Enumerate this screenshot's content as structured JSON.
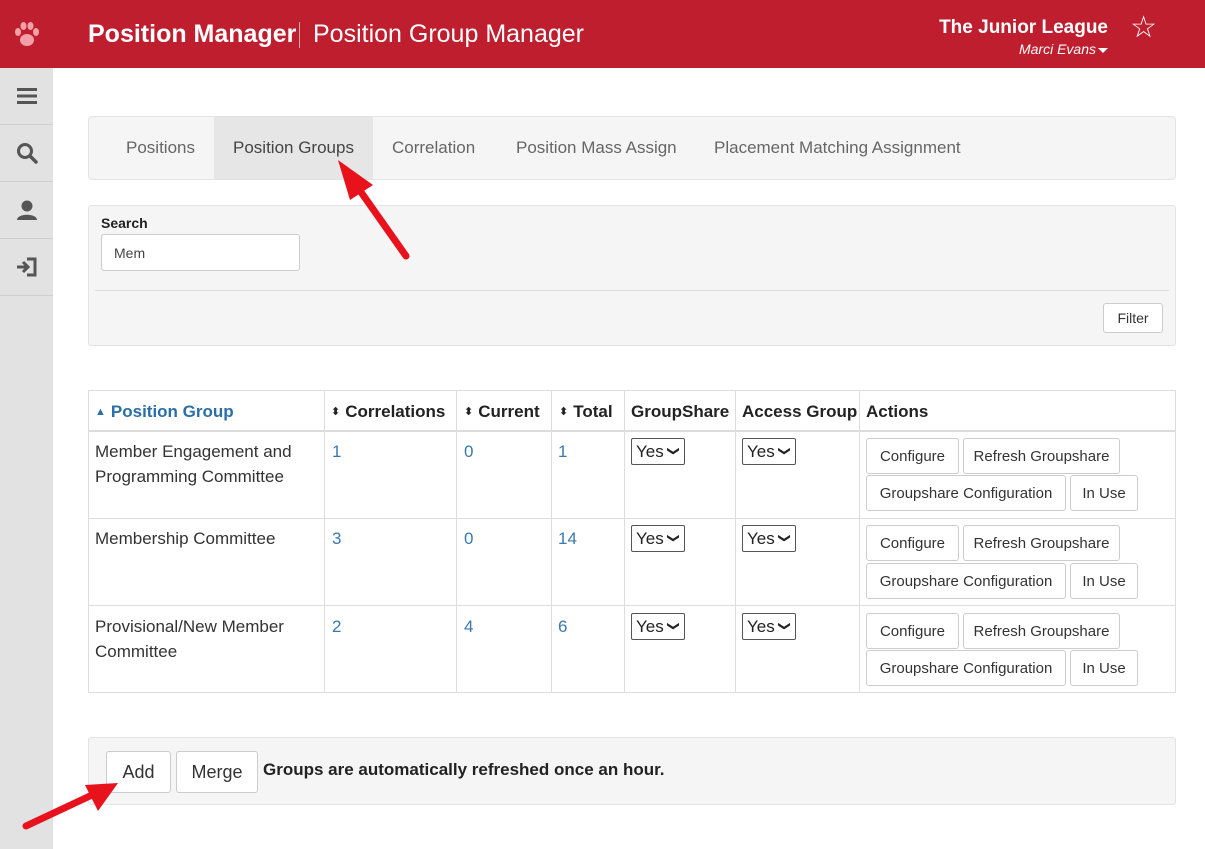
{
  "header": {
    "app_title": "Position Manager",
    "page_title": "Position Group Manager",
    "org_name": "The Junior League",
    "user_name": "Marci Evans",
    "logo_icon": "paw-icon",
    "star_icon": "star-icon",
    "brand_color": "#bf1e2e"
  },
  "sidebar": {
    "items": [
      {
        "icon": "menu-icon"
      },
      {
        "icon": "search-icon"
      },
      {
        "icon": "user-icon"
      },
      {
        "icon": "logout-icon"
      }
    ]
  },
  "tabs": [
    {
      "label": "Positions",
      "active": false
    },
    {
      "label": "Position Groups",
      "active": true
    },
    {
      "label": "Correlation",
      "active": false
    },
    {
      "label": "Position Mass Assign",
      "active": false
    },
    {
      "label": "Placement Matching Assignment",
      "active": false
    }
  ],
  "search": {
    "label": "Search",
    "value": "Mem",
    "filter_label": "Filter"
  },
  "table": {
    "columns": [
      "Position Group",
      "Correlations",
      "Current",
      "Total",
      "GroupShare",
      "Access Group",
      "Actions"
    ],
    "rows": [
      {
        "name_line1": "Member Engagement and",
        "name_line2": "Programming Committee",
        "correlations": "1",
        "current": "0",
        "total": "1",
        "groupshare": "Yes",
        "access_group": "Yes"
      },
      {
        "name_line1": "Membership Committee",
        "name_line2": "",
        "correlations": "3",
        "current": "0",
        "total": "14",
        "groupshare": "Yes",
        "access_group": "Yes"
      },
      {
        "name_line1": "Provisional/New Member",
        "name_line2": "Committee",
        "correlations": "2",
        "current": "4",
        "total": "6",
        "groupshare": "Yes",
        "access_group": "Yes"
      }
    ],
    "actions": {
      "configure": "Configure",
      "refresh": "Refresh Groupshare",
      "groupshare_config": "Groupshare Configuration",
      "in_use": "In Use"
    }
  },
  "footer": {
    "add_label": "Add",
    "merge_label": "Merge",
    "note": "Groups are automatically refreshed once an hour."
  },
  "annotations": {
    "arrow_color": "#e8121c"
  }
}
